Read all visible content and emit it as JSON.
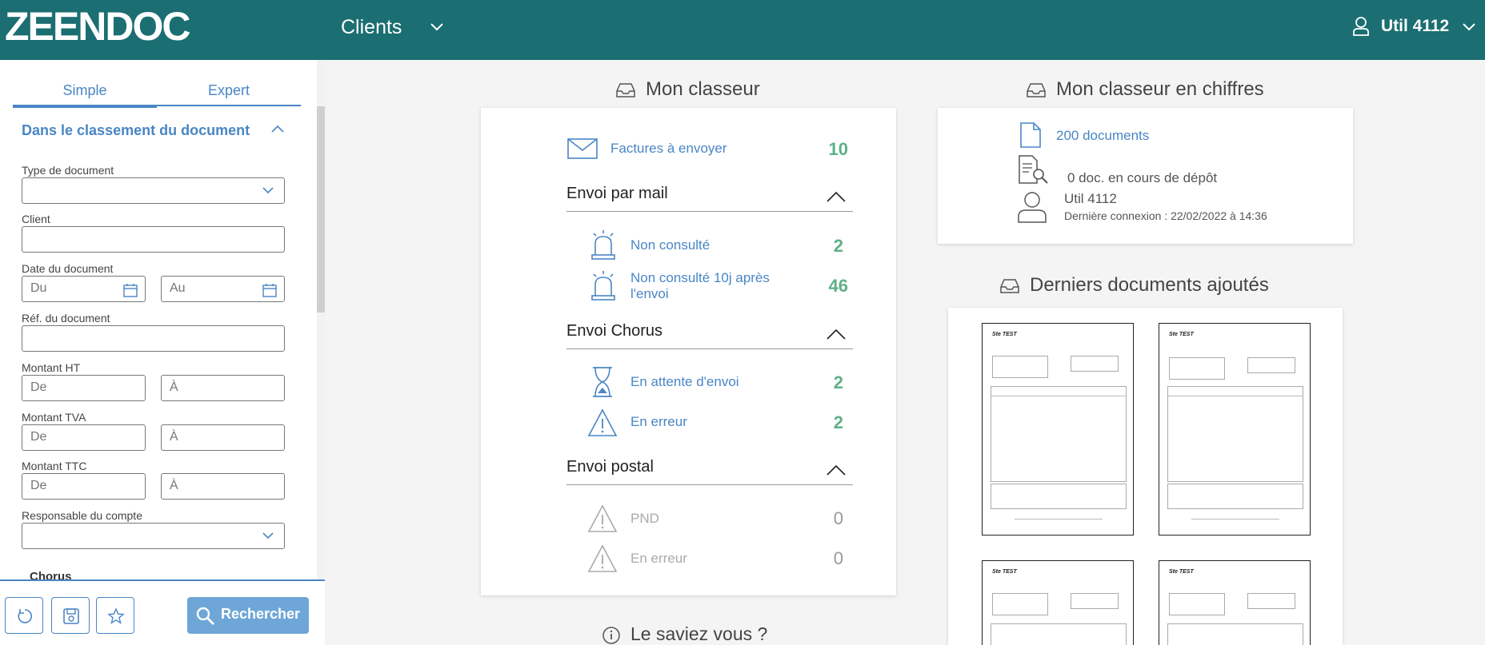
{
  "header": {
    "logo": "ZEENDOC",
    "nav_title": "Clients",
    "user_name": "Util 4112"
  },
  "sidebar": {
    "tabs": {
      "simple": "Simple",
      "expert": "Expert"
    },
    "section_title": "Dans le classement du document",
    "fields": {
      "type_document": "Type de document",
      "client": "Client",
      "date_document": "Date du document",
      "date_from_placeholder": "Du",
      "date_to_placeholder": "Au",
      "ref_document": "Réf. du document",
      "montant_ht": "Montant HT",
      "montant_tva": "Montant TVA",
      "montant_ttc": "Montant TTC",
      "from_placeholder": "De",
      "to_placeholder": "À",
      "responsable": "Responsable du compte"
    },
    "next_section": "Chorus",
    "search_button": "Rechercher"
  },
  "classeur": {
    "title": "Mon classeur",
    "factures": {
      "label": "Factures à envoyer",
      "count": "10"
    },
    "mail": {
      "title": "Envoi par mail",
      "non_consulte": {
        "label": "Non consulté",
        "count": "2"
      },
      "non_consulte_10j": {
        "label_line1": "Non consulté 10j après",
        "label_line2": "l'envoi",
        "count": "46"
      }
    },
    "chorus": {
      "title": "Envoi Chorus",
      "attente": {
        "label": "En attente d'envoi",
        "count": "2"
      },
      "erreur": {
        "label": "En erreur",
        "count": "2"
      }
    },
    "postal": {
      "title": "Envoi postal",
      "pnd": {
        "label": "PND",
        "count": "0"
      },
      "erreur": {
        "label": "En erreur",
        "count": "0"
      }
    }
  },
  "chiffres": {
    "title": "Mon classeur en chiffres",
    "documents": "200 documents",
    "depot": "0 doc. en cours de dépôt",
    "user": "Util 4112",
    "last_login": "Dernière connexion : 22/02/2022 à 14:36"
  },
  "derniers": {
    "title": "Derniers documents ajoutés",
    "thumb_title": "Ste TEST"
  },
  "saviez": {
    "title": "Le saviez vous ?"
  },
  "colors": {
    "header": "#1b6e72",
    "link": "#4a86c5",
    "count": "#5fb085"
  }
}
